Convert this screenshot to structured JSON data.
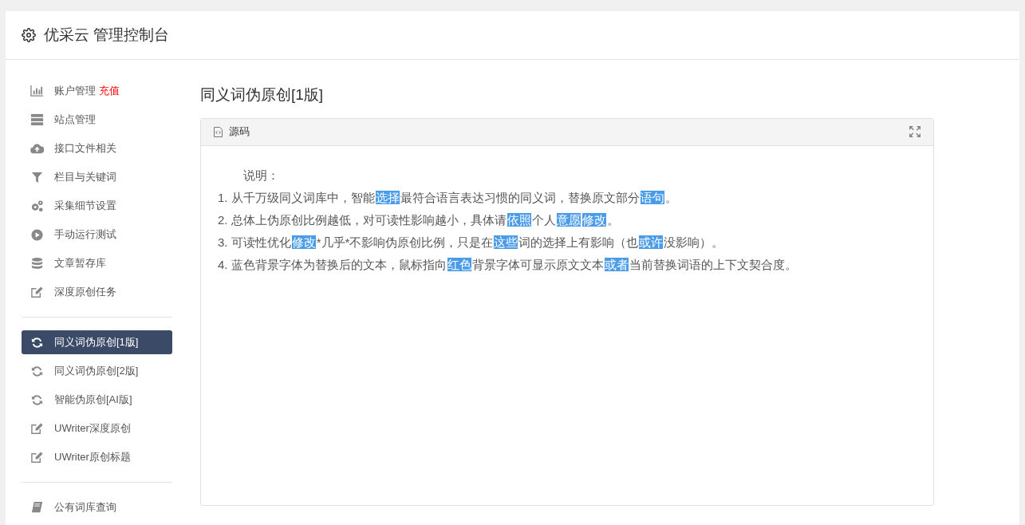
{
  "header": {
    "title": "优采云 管理控制台"
  },
  "sidebar": {
    "groups": [
      {
        "items": [
          {
            "kind": "chart",
            "label": "账户管理",
            "badge": "充值",
            "selected": false
          },
          {
            "kind": "server",
            "label": "站点管理",
            "selected": false
          },
          {
            "kind": "cloud",
            "label": "接口文件相关",
            "selected": false
          },
          {
            "kind": "filter",
            "label": "栏目与关键词",
            "selected": false
          },
          {
            "kind": "cogs",
            "label": "采集细节设置",
            "selected": false
          },
          {
            "kind": "play",
            "label": "手动运行测试",
            "selected": false
          },
          {
            "kind": "database",
            "label": "文章暂存库",
            "selected": false
          },
          {
            "kind": "edit",
            "label": "深度原创任务",
            "selected": false
          }
        ]
      },
      {
        "items": [
          {
            "kind": "refresh",
            "label": "同义词伪原创[1版]",
            "selected": true
          },
          {
            "kind": "refresh",
            "label": "同义词伪原创[2版]",
            "selected": false
          },
          {
            "kind": "refresh",
            "label": "智能伪原创[AI版]",
            "selected": false
          },
          {
            "kind": "edit",
            "label": "UWriter深度原创",
            "selected": false
          },
          {
            "kind": "edit",
            "label": "UWriter原创标题",
            "selected": false
          }
        ]
      },
      {
        "items": [
          {
            "kind": "book",
            "label": "公有词库查询",
            "selected": false
          }
        ]
      }
    ]
  },
  "main": {
    "title": "同义词伪原创[1版]",
    "panel": {
      "tab": "源码",
      "heading": "说明：",
      "lines": [
        [
          {
            "text": "1. 从千万级同义词库中，智能",
            "highlighted": false
          },
          {
            "text": "选择",
            "highlighted": true
          },
          {
            "text": "最符合语言表达习惯的同义词，替换原文部分",
            "highlighted": false
          },
          {
            "text": "语句",
            "highlighted": true
          },
          {
            "text": "。",
            "highlighted": false
          }
        ],
        [
          {
            "text": "2. 总体上伪原创比例越低，对可读性影响越小，具体请",
            "highlighted": false
          },
          {
            "text": "依照",
            "highlighted": true
          },
          {
            "text": "个人",
            "highlighted": false
          },
          {
            "text": "意愿",
            "highlighted": true
          },
          {
            "text": "修改",
            "highlighted": true
          },
          {
            "text": "。",
            "highlighted": false
          }
        ],
        [
          {
            "text": "3. 可读性优化",
            "highlighted": false
          },
          {
            "text": "修改",
            "highlighted": true
          },
          {
            "text": "*几乎*不影响伪原创比例，只是在",
            "highlighted": false
          },
          {
            "text": "这些",
            "highlighted": true
          },
          {
            "text": "词的选择上有影响（也",
            "highlighted": false
          },
          {
            "text": "或许",
            "highlighted": true
          },
          {
            "text": "没影响）。",
            "highlighted": false
          }
        ],
        [
          {
            "text": "4. 蓝色背景字体为替换后的文本，鼠标指向",
            "highlighted": false
          },
          {
            "text": "红色",
            "highlighted": true
          },
          {
            "text": "背景字体可显示原文文本",
            "highlighted": false
          },
          {
            "text": "或者",
            "highlighted": true
          },
          {
            "text": "当前替换词语的上下文契合度。",
            "highlighted": false
          }
        ]
      ]
    }
  }
}
